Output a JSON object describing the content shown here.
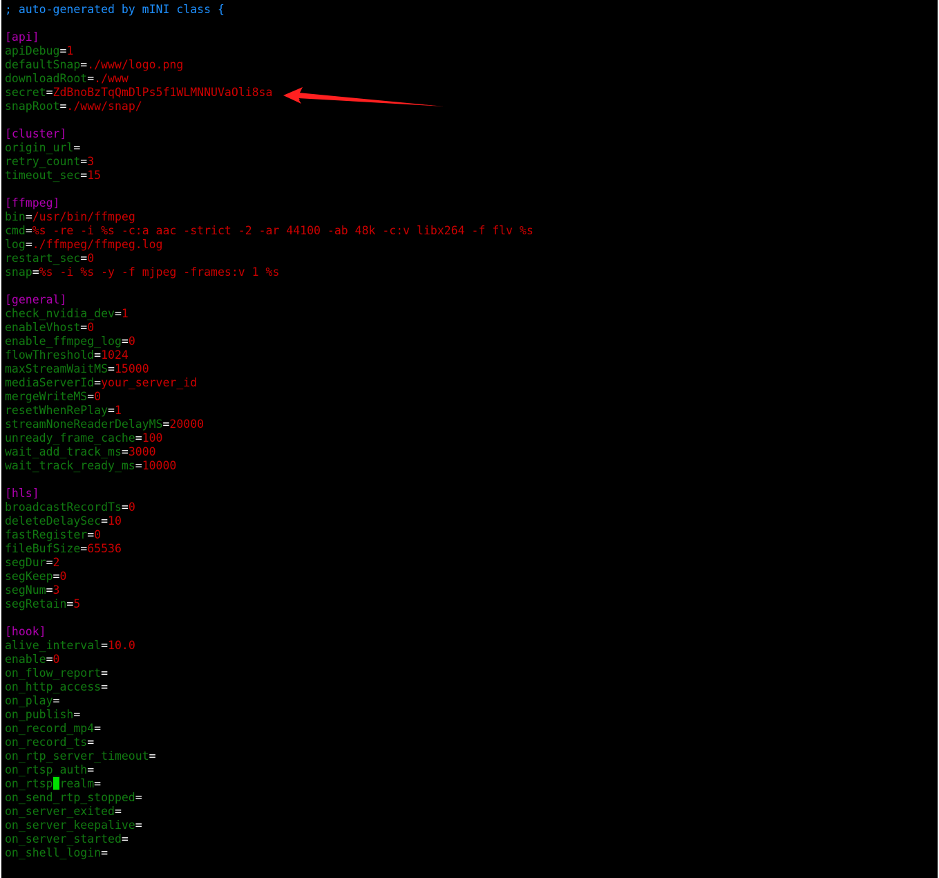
{
  "lines": [
    {
      "type": "comment",
      "text": "; auto-generated by mINI class {"
    },
    {
      "type": "blank"
    },
    {
      "type": "section",
      "text": "[api]"
    },
    {
      "type": "kv",
      "key": "apiDebug",
      "value": "1"
    },
    {
      "type": "kv",
      "key": "defaultSnap",
      "value": "./www/logo.png"
    },
    {
      "type": "kv",
      "key": "downloadRoot",
      "value": "./www"
    },
    {
      "type": "kv",
      "key": "secret",
      "value": "ZdBnoBzTqQmDlPs5f1WLMNNUVaOli8sa",
      "annotated": true
    },
    {
      "type": "kv",
      "key": "snapRoot",
      "value": "./www/snap/"
    },
    {
      "type": "blank"
    },
    {
      "type": "section",
      "text": "[cluster]"
    },
    {
      "type": "kv",
      "key": "origin_url",
      "value": ""
    },
    {
      "type": "kv",
      "key": "retry_count",
      "value": "3"
    },
    {
      "type": "kv",
      "key": "timeout_sec",
      "value": "15"
    },
    {
      "type": "blank"
    },
    {
      "type": "section",
      "text": "[ffmpeg]"
    },
    {
      "type": "kv",
      "key": "bin",
      "value": "/usr/bin/ffmpeg"
    },
    {
      "type": "kv",
      "key": "cmd",
      "value": "%s -re -i %s -c:a aac -strict -2 -ar 44100 -ab 48k -c:v libx264 -f flv %s"
    },
    {
      "type": "kv",
      "key": "log",
      "value": "./ffmpeg/ffmpeg.log"
    },
    {
      "type": "kv",
      "key": "restart_sec",
      "value": "0"
    },
    {
      "type": "kv",
      "key": "snap",
      "value": "%s -i %s -y -f mjpeg -frames:v 1 %s"
    },
    {
      "type": "blank"
    },
    {
      "type": "section",
      "text": "[general]"
    },
    {
      "type": "kv",
      "key": "check_nvidia_dev",
      "value": "1"
    },
    {
      "type": "kv",
      "key": "enableVhost",
      "value": "0"
    },
    {
      "type": "kv",
      "key": "enable_ffmpeg_log",
      "value": "0"
    },
    {
      "type": "kv",
      "key": "flowThreshold",
      "value": "1024"
    },
    {
      "type": "kv",
      "key": "maxStreamWaitMS",
      "value": "15000"
    },
    {
      "type": "kv",
      "key": "mediaServerId",
      "value": "your_server_id"
    },
    {
      "type": "kv",
      "key": "mergeWriteMS",
      "value": "0"
    },
    {
      "type": "kv",
      "key": "resetWhenRePlay",
      "value": "1"
    },
    {
      "type": "kv",
      "key": "streamNoneReaderDelayMS",
      "value": "20000"
    },
    {
      "type": "kv",
      "key": "unready_frame_cache",
      "value": "100"
    },
    {
      "type": "kv",
      "key": "wait_add_track_ms",
      "value": "3000"
    },
    {
      "type": "kv",
      "key": "wait_track_ready_ms",
      "value": "10000"
    },
    {
      "type": "blank"
    },
    {
      "type": "section",
      "text": "[hls]"
    },
    {
      "type": "kv",
      "key": "broadcastRecordTs",
      "value": "0"
    },
    {
      "type": "kv",
      "key": "deleteDelaySec",
      "value": "10"
    },
    {
      "type": "kv",
      "key": "fastRegister",
      "value": "0"
    },
    {
      "type": "kv",
      "key": "fileBufSize",
      "value": "65536"
    },
    {
      "type": "kv",
      "key": "segDur",
      "value": "2"
    },
    {
      "type": "kv",
      "key": "segKeep",
      "value": "0"
    },
    {
      "type": "kv",
      "key": "segNum",
      "value": "3"
    },
    {
      "type": "kv",
      "key": "segRetain",
      "value": "5"
    },
    {
      "type": "blank"
    },
    {
      "type": "section",
      "text": "[hook]"
    },
    {
      "type": "kv",
      "key": "alive_interval",
      "value": "10.0"
    },
    {
      "type": "kv",
      "key": "enable",
      "value": "0"
    },
    {
      "type": "kv",
      "key": "on_flow_report",
      "value": ""
    },
    {
      "type": "kv",
      "key": "on_http_access",
      "value": ""
    },
    {
      "type": "kv",
      "key": "on_play",
      "value": ""
    },
    {
      "type": "kv",
      "key": "on_publish",
      "value": ""
    },
    {
      "type": "kv",
      "key": "on_record_mp4",
      "value": ""
    },
    {
      "type": "kv",
      "key": "on_record_ts",
      "value": ""
    },
    {
      "type": "kv",
      "key": "on_rtp_server_timeout",
      "value": ""
    },
    {
      "type": "kv",
      "key": "on_rtsp_auth",
      "value": ""
    },
    {
      "type": "kv",
      "key": "on_rtsp_realm",
      "value": "",
      "cursor_at": 7
    },
    {
      "type": "kv",
      "key": "on_send_rtp_stopped",
      "value": ""
    },
    {
      "type": "kv",
      "key": "on_server_exited",
      "value": ""
    },
    {
      "type": "kv",
      "key": "on_server_keepalive",
      "value": ""
    },
    {
      "type": "kv",
      "key": "on_server_started",
      "value": ""
    },
    {
      "type": "kv",
      "key": "on_shell_login",
      "value": ""
    }
  ],
  "colors": {
    "background": "#000000",
    "comment": "#1e90ff",
    "section": "#b000b0",
    "key": "#117a11",
    "equals": "#ffffff",
    "value": "#cc0000",
    "cursor": "#00e000",
    "annotation_arrow": "#ff2020"
  }
}
